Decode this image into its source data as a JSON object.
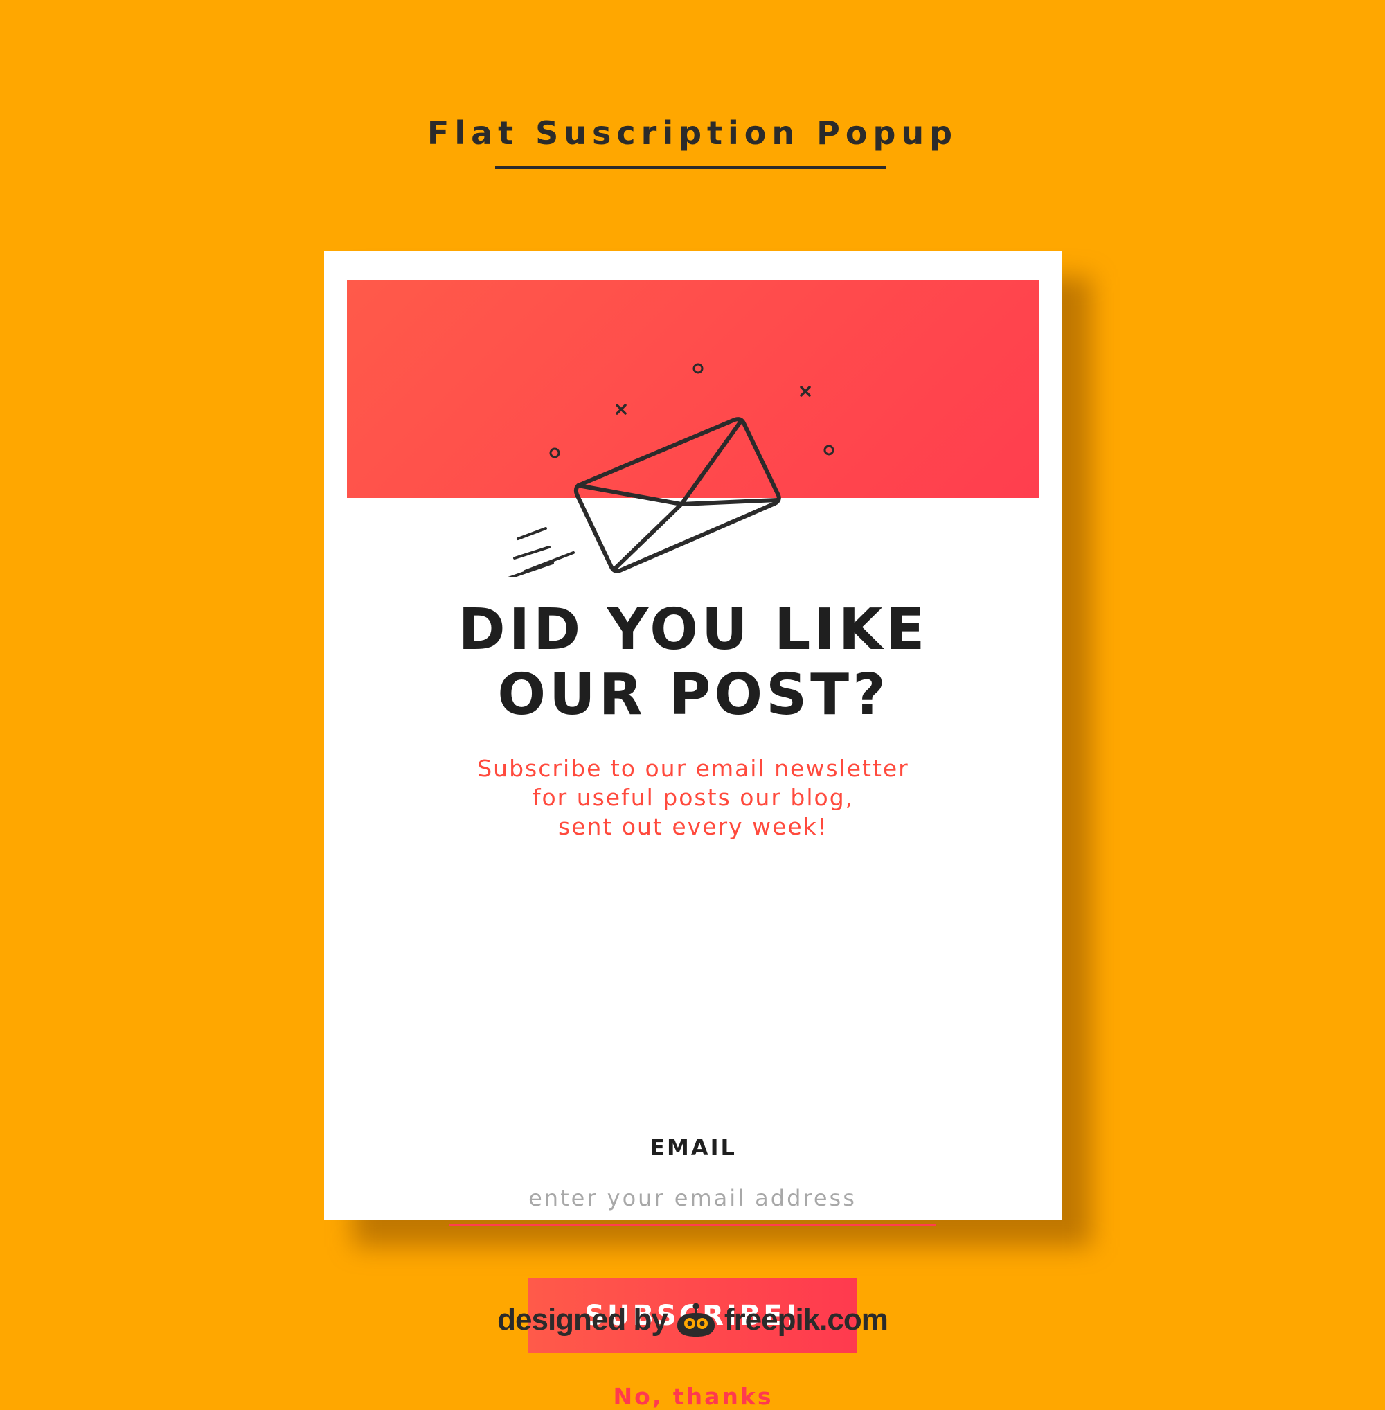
{
  "header": {
    "title": "Flat Suscription Popup"
  },
  "popup": {
    "headline_line1": "DID YOU LIKE",
    "headline_line2": "OUR POST?",
    "subtext_line1": "Subscribe to our email newsletter",
    "subtext_line2": "for useful posts our blog,",
    "subtext_line3": "sent out every week!",
    "email_label": "EMAIL",
    "email_placeholder": "enter your email address",
    "email_value": "",
    "subscribe_label": "SUBSCRIBE!",
    "dismiss_label": "No, thanks",
    "icon": "envelope-icon"
  },
  "footer": {
    "designed_by": "designed by",
    "brand": "freepik.com",
    "logo_icon": "freepik-logo-icon"
  },
  "colors": {
    "background": "#FFA700",
    "accent": "#FF4A3D",
    "accent_dark": "#FF3E4E",
    "text_dark": "#1f1f1f"
  }
}
